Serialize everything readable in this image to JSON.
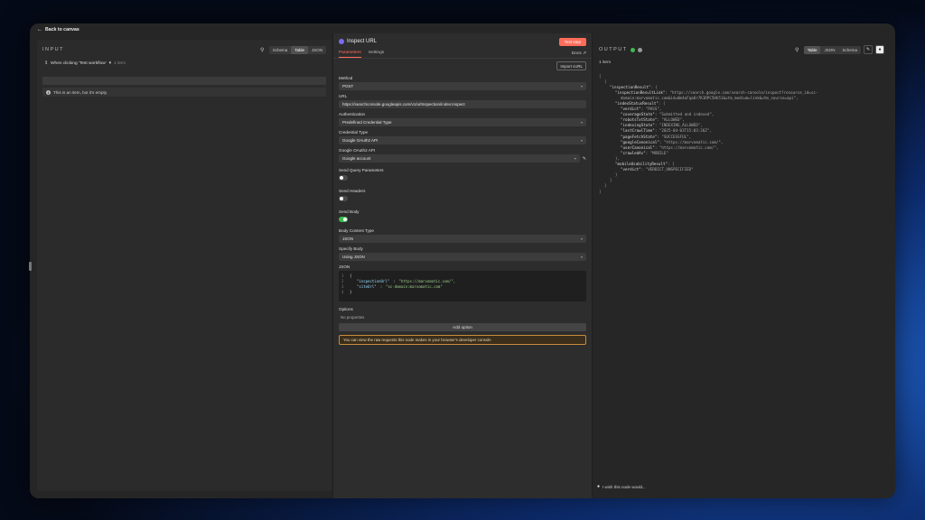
{
  "topbar": {
    "back_label": "Back to canvas"
  },
  "input_panel": {
    "title": "INPUT",
    "tabs": [
      "Schema",
      "Table",
      "JSON"
    ],
    "active_tab": "Table",
    "trigger_label": "When clicking 'Test workflow'",
    "trigger_suffix": "1 item",
    "empty_message": "This is an item, but it's empty."
  },
  "node": {
    "title": "Inspect URL",
    "test_step": "Test step",
    "tabs": [
      "Parameters",
      "Settings"
    ],
    "docs": "Docs ⇗",
    "import_curl": "Import cURL",
    "fields": {
      "method_label": "Method",
      "method_value": "POST",
      "url_label": "URL",
      "url_value": "https://searchconsole.googleapis.com/v1/urlInspection/index:inspect",
      "auth_label": "Authentication",
      "auth_value": "Predefined Credential Type",
      "cred_type_label": "Credential Type",
      "cred_type_value": "Google OAuth2 API",
      "oauth_label": "Google OAuth2 API",
      "oauth_value": "Google account",
      "send_query_label": "Send Query Parameters",
      "send_headers_label": "Send Headers",
      "send_body_label": "Send Body",
      "body_type_label": "Body Content Type",
      "body_type_value": "JSON",
      "specify_body_label": "Specify Body",
      "specify_body_value": "Using JSON",
      "json_label": "JSON"
    },
    "json_lines": [
      {
        "n": "1",
        "text": "{"
      },
      {
        "n": "2",
        "key": "\"inspectionUrl\"",
        "val": "\"https://marvomatic.com/\","
      },
      {
        "n": "3",
        "key": "\"siteUrl\"",
        "val": "\"sc-domain:marvomatic.com\""
      },
      {
        "n": "4",
        "text": "}"
      }
    ],
    "options_label": "Options",
    "no_properties": "No properties",
    "add_option": "Add option",
    "warning": "You can view the raw requests this node makes in your browser's developer console"
  },
  "output_panel": {
    "title": "OUTPUT",
    "tabs": [
      "Table",
      "JSON",
      "Schema"
    ],
    "active_tab": "Table",
    "item_count": "1 item",
    "json_lines": [
      {
        "indent": 0,
        "text": "["
      },
      {
        "indent": 1,
        "text": "{"
      },
      {
        "indent": 2,
        "key": "\"inspectionResult\"",
        "text": ": {"
      },
      {
        "indent": 3,
        "key": "\"inspectionResultLink\"",
        "val": ": \"https://search.google.com/search-console/inspect?resource_id=sc-"
      },
      {
        "indent": 4,
        "val": "domain:marvomatic.com&id=0m4oFqa8r7K1RPC5Hh51&utm_medium=link&utm_source=api\","
      },
      {
        "indent": 3,
        "key": "\"indexStatusResult\"",
        "text": ": {"
      },
      {
        "indent": 4,
        "key": "\"verdict\"",
        "val": ": \"PASS\","
      },
      {
        "indent": 4,
        "key": "\"coverageState\"",
        "val": ": \"Submitted and indexed\","
      },
      {
        "indent": 4,
        "key": "\"robotsTxtState\"",
        "val": ": \"ALLOWED\","
      },
      {
        "indent": 4,
        "key": "\"indexingState\"",
        "val": ": \"INDEXING_ALLOWED\","
      },
      {
        "indent": 4,
        "key": "\"lastCrawlTime\"",
        "val": ": \"2025-04-03T15:03:26Z\","
      },
      {
        "indent": 4,
        "key": "\"pageFetchState\"",
        "val": ": \"SUCCESSFUL\","
      },
      {
        "indent": 4,
        "key": "\"googleCanonical\"",
        "val": ": \"https://marvomatic.com/\","
      },
      {
        "indent": 4,
        "key": "\"userCanonical\"",
        "val": ": \"https://marvomatic.com/\","
      },
      {
        "indent": 4,
        "key": "\"crawledAs\"",
        "val": ": \"MOBILE\""
      },
      {
        "indent": 3,
        "text": "},"
      },
      {
        "indent": 3,
        "key": "\"mobileUsabilityResult\"",
        "text": ": {"
      },
      {
        "indent": 4,
        "key": "\"verdict\"",
        "val": ": \"VERDICT_UNSPECIFIED\""
      },
      {
        "indent": 3,
        "text": "}"
      },
      {
        "indent": 2,
        "text": "}"
      },
      {
        "indent": 1,
        "text": "}"
      },
      {
        "indent": 0,
        "text": "]"
      }
    ],
    "footer_note": "I wish this node would..."
  },
  "colors": {
    "accent": "#ff6d5a",
    "success": "#3fb950",
    "warning_border": "#c78c3a"
  },
  "icons": [
    "search-icon",
    "pencil-icon",
    "pin-icon",
    "info-icon",
    "lightbulb-icon",
    "chevron-down-icon",
    "back-arrow-icon"
  ]
}
